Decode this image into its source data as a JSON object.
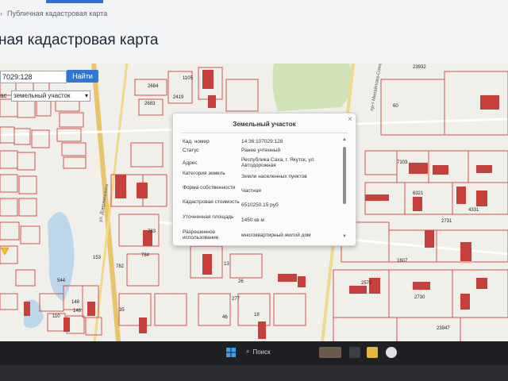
{
  "breadcrumb": {
    "home": "›",
    "page": "Публичная кадастровая карта"
  },
  "page": {
    "title": "ная кадастровая карта"
  },
  "search": {
    "value": "7029:128",
    "button": "Найти"
  },
  "object_type": {
    "label": "ас",
    "selected": "земельный участок"
  },
  "popup": {
    "title": "Земельный участок",
    "close": "×",
    "rows": [
      {
        "key": "Кад. номер",
        "value": "14:36:107029:128"
      },
      {
        "key": "Статус",
        "value": "Ранее учтенный"
      },
      {
        "key": "Адрес",
        "value": "Республика Саха, г. Якутск, ул. Автодорожная"
      },
      {
        "key": "Категория земель",
        "value": "Земли населенных пунктов"
      },
      {
        "key": "Форма собственности",
        "value": "Частная"
      },
      {
        "key": "Кадастровая стоимость",
        "value": "6510250.15 руб"
      },
      {
        "key": "Уточненная площадь",
        "value": "1450 кв м"
      },
      {
        "key": "Разрешенное использование",
        "value": "многоквартирный жилой дом"
      }
    ]
  },
  "map_labels": {
    "streets": [
      "ул. Автодорожная",
      "ул. Дзержинского",
      "пр-т Михайлова-Соколова"
    ],
    "parcels": [
      "2684",
      "1105",
      "2683",
      "2419",
      "23932",
      "60",
      "7103",
      "6321",
      "4331",
      "2731",
      "1607",
      "2570",
      "2730",
      "23947",
      "783",
      "782",
      "784",
      "544",
      "153",
      "148",
      "146",
      "110",
      "35",
      "277",
      "46",
      "18",
      "26",
      "13",
      "55"
    ]
  },
  "taskbar": {
    "search": "Поиск"
  },
  "colors": {
    "accent": "#2f77d6",
    "parcel_stroke": "#d2564f",
    "building": "#c8403b",
    "green": "#cfe3b6",
    "water": "#bcd6ea"
  }
}
